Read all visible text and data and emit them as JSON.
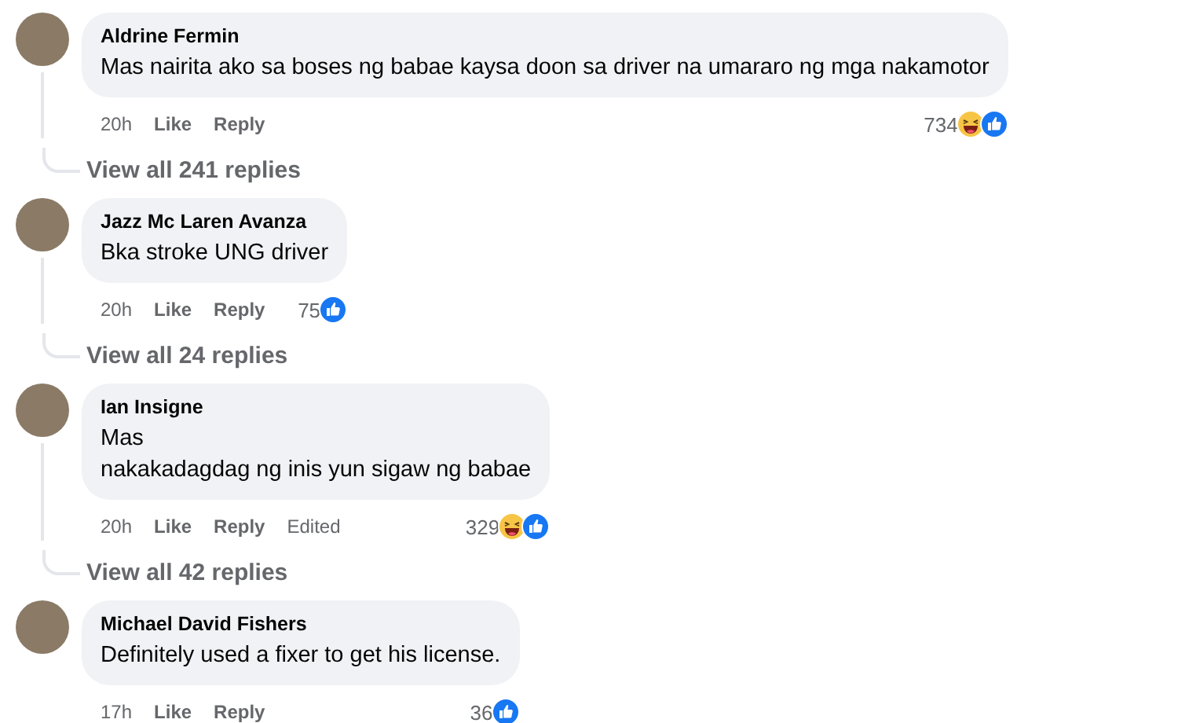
{
  "comments": [
    {
      "author": "Aldrine Fermin",
      "text": "Mas nairita ako sa boses ng babae kaysa doon sa driver na umararo ng mga nakamotor",
      "time": "20h",
      "actions": [
        "Like",
        "Reply"
      ],
      "reaction_count": "734",
      "reactions": [
        {
          "kind": "haha"
        },
        {
          "kind": "like"
        }
      ],
      "replies_link": "View all 241 replies"
    },
    {
      "author": "Jazz Mc Laren Avanza",
      "text": "Bka stroke UNG driver",
      "time": "20h",
      "actions": [
        "Like",
        "Reply"
      ],
      "reaction_count": "75",
      "reactions": [
        {
          "kind": "like"
        }
      ],
      "replies_link": "View all 24 replies"
    },
    {
      "author": "Ian Insigne",
      "text": "Mas\nnakakadagdag ng inis yun sigaw ng babae",
      "time": "20h",
      "actions": [
        "Like",
        "Reply"
      ],
      "edited": "Edited",
      "reaction_count": "329",
      "reactions": [
        {
          "kind": "haha"
        },
        {
          "kind": "like"
        }
      ],
      "replies_link": "View all 42 replies"
    },
    {
      "author": "Michael David Fishers",
      "text": "Definitely used a fixer to get his license.",
      "time": "17h",
      "actions": [
        "Like",
        "Reply"
      ],
      "reaction_count": "36",
      "reactions": [
        {
          "kind": "like"
        }
      ]
    }
  ]
}
